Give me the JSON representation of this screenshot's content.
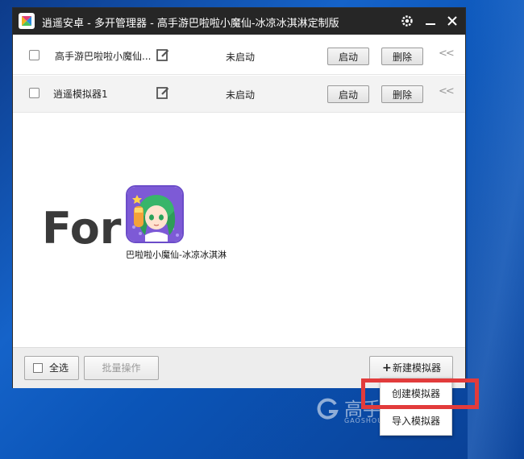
{
  "window": {
    "title": "逍遥安卓 - 多开管理器 - 高手游巴啦啦小魔仙-冰凉冰淇淋定制版",
    "settings_icon": "gear-icon",
    "minimize_icon": "minimize-icon",
    "close_icon": "close-icon"
  },
  "emulators": [
    {
      "name": "高手游巴啦啦小魔仙...",
      "status": "未启动",
      "start_label": "启动",
      "delete_label": "删除",
      "expand_label": "<<"
    },
    {
      "name": "逍遥模拟器1",
      "status": "未启动",
      "start_label": "启动",
      "delete_label": "删除",
      "expand_label": "<<"
    }
  ],
  "banner": {
    "for_text": "For",
    "game_name": "巴啦啦小魔仙-冰凉冰淇淋"
  },
  "footer": {
    "select_all_label": "全选",
    "batch_label": "批量操作",
    "new_emulator_label": "新建模拟器",
    "new_emulator_icon": "plus-icon"
  },
  "menu": {
    "items": [
      "创建模拟器",
      "导入模拟器"
    ]
  },
  "watermark": {
    "brand": "高手游",
    "sub": "GAOSHOUYOU"
  },
  "colors": {
    "titlebar": "#262626",
    "highlight": "#e23b3b",
    "desktop": "#1563c9"
  }
}
